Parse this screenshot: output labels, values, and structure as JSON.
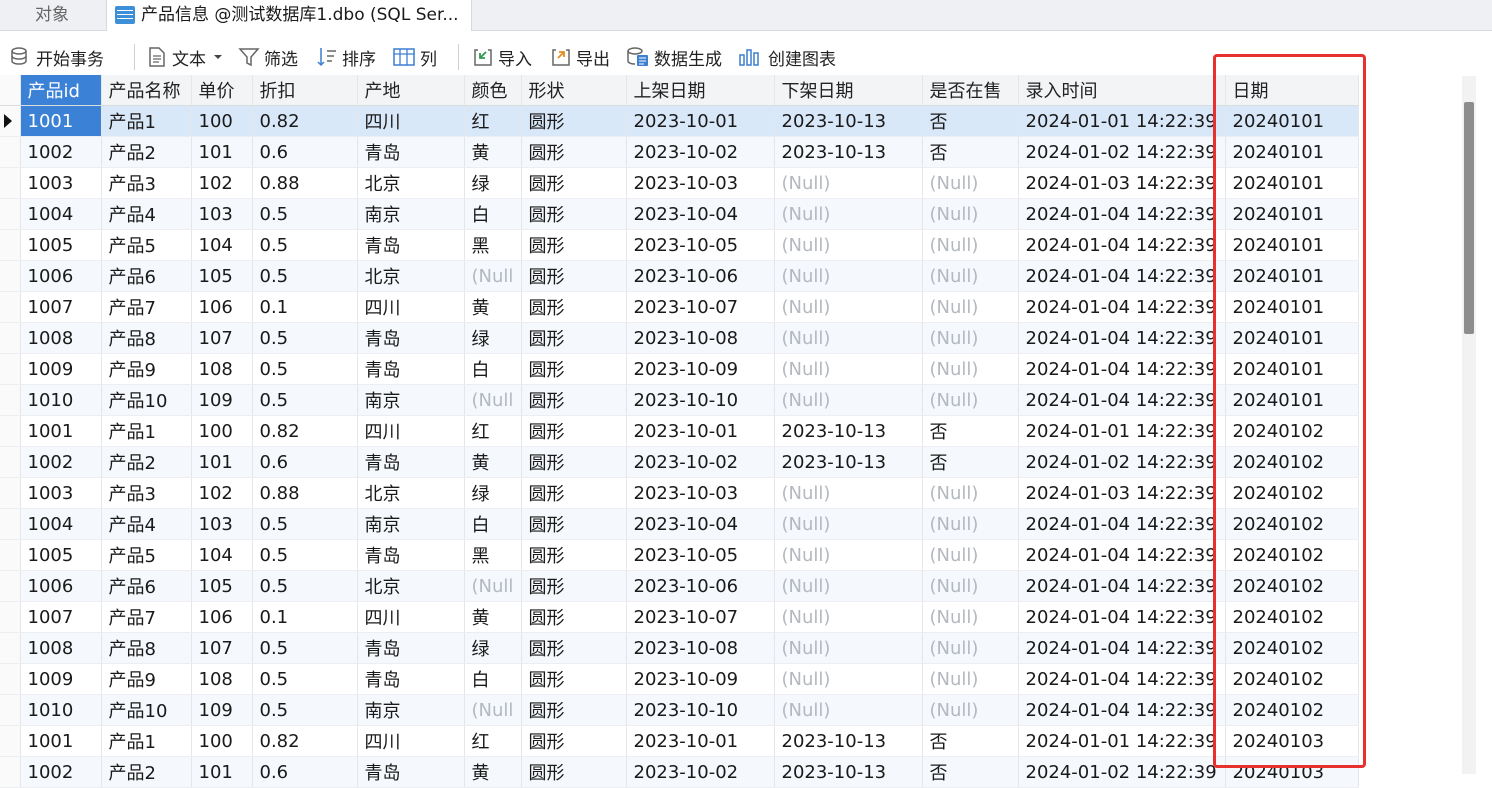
{
  "tabs": {
    "objects_tab": "对象",
    "active_tab": "产品信息 @测试数据库1.dbo (SQL Ser..."
  },
  "toolbar": {
    "begin_transaction": "开始事务",
    "text": "文本",
    "filter": "筛选",
    "sort": "排序",
    "columns": "列",
    "import": "导入",
    "export": "导出",
    "data_generation": "数据生成",
    "create_chart": "创建图表"
  },
  "colors": {
    "highlight_box": "#e8312f",
    "selected_row": "#d9e8f8",
    "selected_cell": "#3b82d6",
    "null_text": "#b4b8bf"
  },
  "grid": {
    "columns": [
      "产品id",
      "产品名称",
      "单价",
      "折扣",
      "产地",
      "颜色",
      "形状",
      "上架日期",
      "下架日期",
      "是否在售",
      "录入时间",
      "日期"
    ],
    "rows": [
      [
        "1001",
        "产品1",
        "100",
        "0.82",
        "四川",
        "红",
        "圆形",
        "2023-10-01",
        "2023-10-13",
        "否",
        "2024-01-01 14:22:39",
        "20240101"
      ],
      [
        "1002",
        "产品2",
        "101",
        "0.6",
        "青岛",
        "黄",
        "圆形",
        "2023-10-02",
        "2023-10-13",
        "否",
        "2024-01-02 14:22:39",
        "20240101"
      ],
      [
        "1003",
        "产品3",
        "102",
        "0.88",
        "北京",
        "绿",
        "圆形",
        "2023-10-03",
        "(Null)",
        "(Null)",
        "2024-01-03 14:22:39",
        "20240101"
      ],
      [
        "1004",
        "产品4",
        "103",
        "0.5",
        "南京",
        "白",
        "圆形",
        "2023-10-04",
        "(Null)",
        "(Null)",
        "2024-01-04 14:22:39",
        "20240101"
      ],
      [
        "1005",
        "产品5",
        "104",
        "0.5",
        "青岛",
        "黑",
        "圆形",
        "2023-10-05",
        "(Null)",
        "(Null)",
        "2024-01-04 14:22:39",
        "20240101"
      ],
      [
        "1006",
        "产品6",
        "105",
        "0.5",
        "北京",
        "(Null",
        "圆形",
        "2023-10-06",
        "(Null)",
        "(Null)",
        "2024-01-04 14:22:39",
        "20240101"
      ],
      [
        "1007",
        "产品7",
        "106",
        "0.1",
        "四川",
        "黄",
        "圆形",
        "2023-10-07",
        "(Null)",
        "(Null)",
        "2024-01-04 14:22:39",
        "20240101"
      ],
      [
        "1008",
        "产品8",
        "107",
        "0.5",
        "青岛",
        "绿",
        "圆形",
        "2023-10-08",
        "(Null)",
        "(Null)",
        "2024-01-04 14:22:39",
        "20240101"
      ],
      [
        "1009",
        "产品9",
        "108",
        "0.5",
        "青岛",
        "白",
        "圆形",
        "2023-10-09",
        "(Null)",
        "(Null)",
        "2024-01-04 14:22:39",
        "20240101"
      ],
      [
        "1010",
        "产品10",
        "109",
        "0.5",
        "南京",
        "(Null",
        "圆形",
        "2023-10-10",
        "(Null)",
        "(Null)",
        "2024-01-04 14:22:39",
        "20240101"
      ],
      [
        "1001",
        "产品1",
        "100",
        "0.82",
        "四川",
        "红",
        "圆形",
        "2023-10-01",
        "2023-10-13",
        "否",
        "2024-01-01 14:22:39",
        "20240102"
      ],
      [
        "1002",
        "产品2",
        "101",
        "0.6",
        "青岛",
        "黄",
        "圆形",
        "2023-10-02",
        "2023-10-13",
        "否",
        "2024-01-02 14:22:39",
        "20240102"
      ],
      [
        "1003",
        "产品3",
        "102",
        "0.88",
        "北京",
        "绿",
        "圆形",
        "2023-10-03",
        "(Null)",
        "(Null)",
        "2024-01-03 14:22:39",
        "20240102"
      ],
      [
        "1004",
        "产品4",
        "103",
        "0.5",
        "南京",
        "白",
        "圆形",
        "2023-10-04",
        "(Null)",
        "(Null)",
        "2024-01-04 14:22:39",
        "20240102"
      ],
      [
        "1005",
        "产品5",
        "104",
        "0.5",
        "青岛",
        "黑",
        "圆形",
        "2023-10-05",
        "(Null)",
        "(Null)",
        "2024-01-04 14:22:39",
        "20240102"
      ],
      [
        "1006",
        "产品6",
        "105",
        "0.5",
        "北京",
        "(Null",
        "圆形",
        "2023-10-06",
        "(Null)",
        "(Null)",
        "2024-01-04 14:22:39",
        "20240102"
      ],
      [
        "1007",
        "产品7",
        "106",
        "0.1",
        "四川",
        "黄",
        "圆形",
        "2023-10-07",
        "(Null)",
        "(Null)",
        "2024-01-04 14:22:39",
        "20240102"
      ],
      [
        "1008",
        "产品8",
        "107",
        "0.5",
        "青岛",
        "绿",
        "圆形",
        "2023-10-08",
        "(Null)",
        "(Null)",
        "2024-01-04 14:22:39",
        "20240102"
      ],
      [
        "1009",
        "产品9",
        "108",
        "0.5",
        "青岛",
        "白",
        "圆形",
        "2023-10-09",
        "(Null)",
        "(Null)",
        "2024-01-04 14:22:39",
        "20240102"
      ],
      [
        "1010",
        "产品10",
        "109",
        "0.5",
        "南京",
        "(Null",
        "圆形",
        "2023-10-10",
        "(Null)",
        "(Null)",
        "2024-01-04 14:22:39",
        "20240102"
      ],
      [
        "1001",
        "产品1",
        "100",
        "0.82",
        "四川",
        "红",
        "圆形",
        "2023-10-01",
        "2023-10-13",
        "否",
        "2024-01-01 14:22:39",
        "20240103"
      ],
      [
        "1002",
        "产品2",
        "101",
        "0.6",
        "青岛",
        "黄",
        "圆形",
        "2023-10-02",
        "2023-10-13",
        "否",
        "2024-01-02 14:22:39",
        "20240103"
      ]
    ]
  }
}
